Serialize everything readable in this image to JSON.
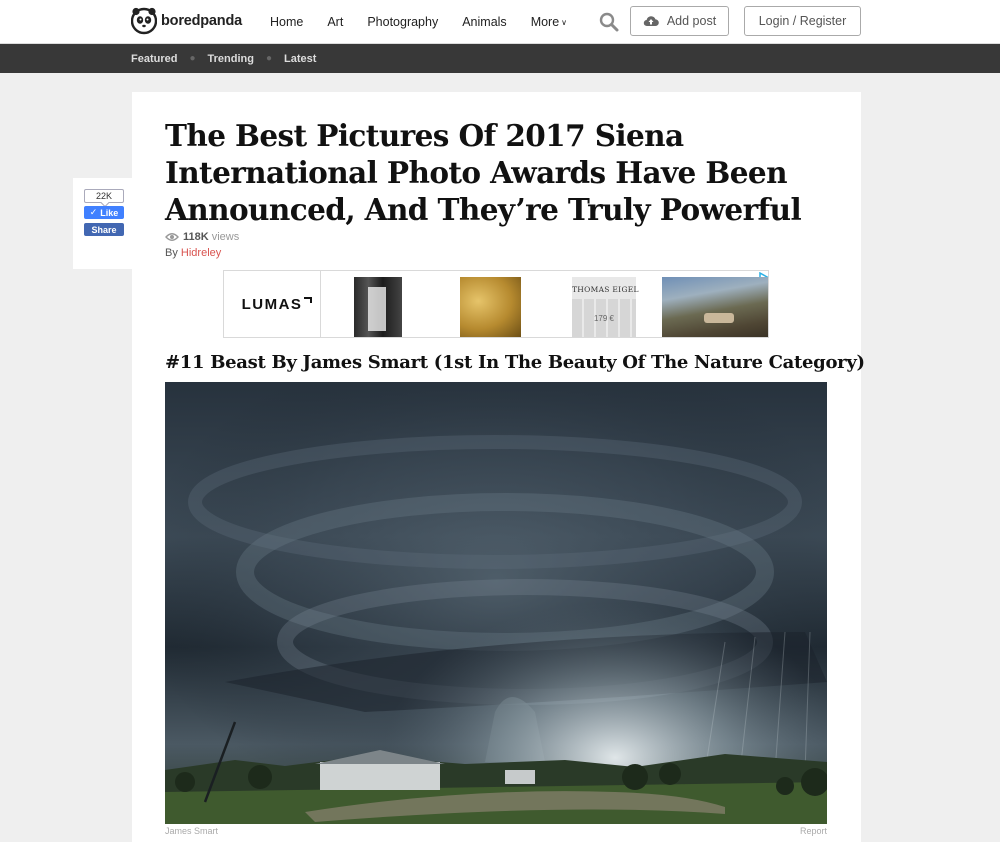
{
  "header": {
    "logo_text": "boredpanda",
    "nav": [
      "Home",
      "Art",
      "Photography",
      "Animals",
      "More"
    ],
    "add_post": "Add post",
    "login": "Login / Register"
  },
  "subnav": [
    "Featured",
    "Trending",
    "Latest"
  ],
  "social": {
    "like_count": "22K",
    "like_label": "Like",
    "share_label": "Share"
  },
  "article": {
    "title": "The Best Pictures Of 2017 Siena International Photo Awards Have Been Announced, And They’re Truly Powerful",
    "views_count": "118K",
    "views_label": "views",
    "by_label": "By",
    "author": "Hidreley"
  },
  "ad": {
    "brand": "LUMAS",
    "artist": "THOMAS EIGEL",
    "price": "179 €"
  },
  "item": {
    "caption": "#11 Beast By James Smart (1st In The Beauty Of The Nature Category)",
    "credit": "James Smart",
    "report": "Report"
  },
  "icons": [
    "panda-logo-icon",
    "caret-down-icon",
    "search-icon",
    "cloud-upload-icon",
    "check-icon",
    "eye-icon",
    "adchoices-icon"
  ],
  "colors": {
    "subnav_bg": "#383838",
    "author_link": "#d9534f",
    "fb_like": "#4080ff",
    "fb_share": "#4267b2"
  }
}
